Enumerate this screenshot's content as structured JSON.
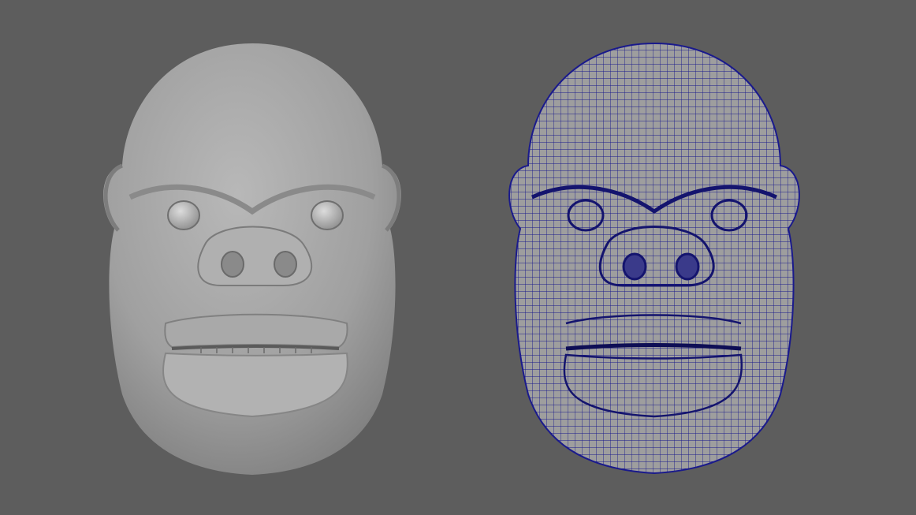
{
  "viewport": {
    "background": "#5d5d5d",
    "panel": "perspective"
  },
  "models": [
    {
      "id": "shaded",
      "display_mode": "smooth-shaded",
      "surface_color": "#a9a9a9"
    },
    {
      "id": "wireframe-on-shaded",
      "display_mode": "wireframe-on-shaded",
      "surface_color": "#a9a9a9",
      "wire_color": "#1a1a8c"
    }
  ],
  "icons": [
    "head-model-shaded",
    "head-model-wireframe"
  ]
}
